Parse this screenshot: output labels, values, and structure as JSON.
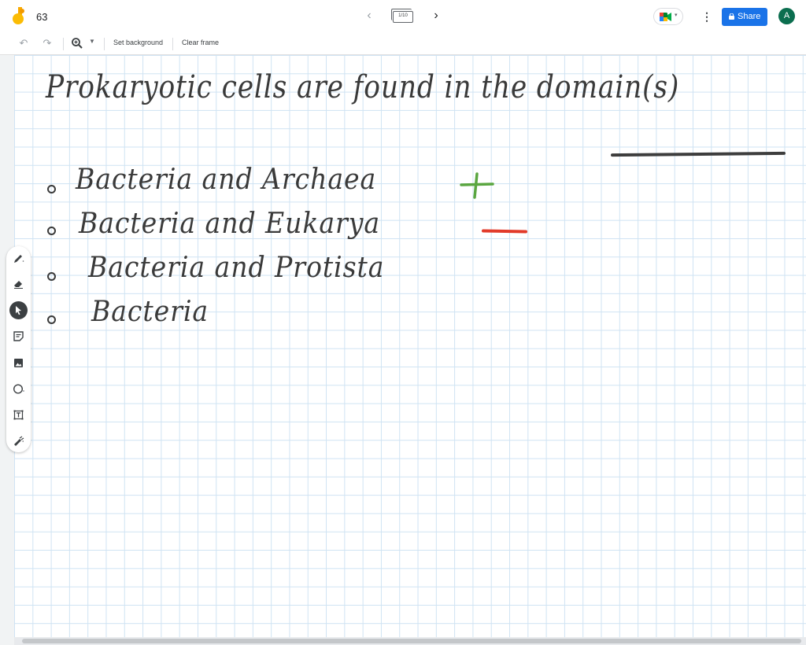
{
  "app": {
    "title": "63",
    "frame_indicator": "1/10",
    "share_label": "Share",
    "avatar_initial": "A",
    "brand_color": "#1a73e8",
    "avatar_color": "#0b6e4f"
  },
  "toolbar": {
    "set_background": "Set background",
    "clear_frame": "Clear frame"
  },
  "tools": [
    "pen-icon",
    "eraser-icon",
    "select-icon",
    "sticky-note-icon",
    "image-icon",
    "circle-icon",
    "text-box-icon",
    "laser-icon"
  ],
  "canvas": {
    "question": "Prokaryotic cells are found in the domain(s)",
    "options": [
      "Bacteria and Archaea",
      "Bacteria and Eukarya",
      "Bacteria and Protista",
      "Bacteria"
    ],
    "marks": {
      "correct_symbol": "+",
      "correct_color": "#4caf50",
      "wrong_symbol": "—",
      "wrong_color": "#e23b2a"
    }
  }
}
